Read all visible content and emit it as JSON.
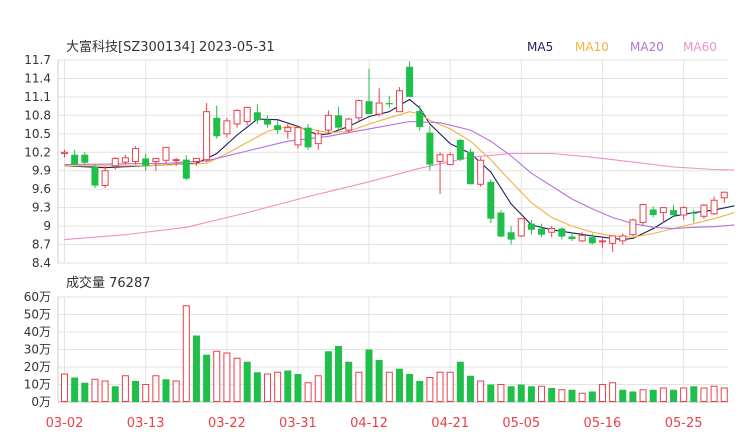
{
  "header": {
    "title": "大富科技[SZ300134] 2023-05-31",
    "legend": [
      {
        "label": "MA5",
        "color": "#1f1f5c"
      },
      {
        "label": "MA10",
        "color": "#f2b143"
      },
      {
        "label": "MA20",
        "color": "#b073d9"
      },
      {
        "label": "MA60",
        "color": "#f08fc8"
      }
    ]
  },
  "volume_header": {
    "label": "成交量 76287"
  },
  "colors": {
    "up": "#e8414a",
    "down": "#1fbf4a",
    "grid": "#e3e3e3",
    "axis_text": "#333333"
  },
  "chart_data": [
    {
      "type": "candlestick",
      "title": "大富科技[SZ300134] 2023-05-31",
      "y_ticks": [
        "11.7",
        "11.4",
        "11.1",
        "10.8",
        "10.5",
        "10.2",
        "9.9",
        "9.6",
        "9.3",
        "9",
        "8.7",
        "8.4"
      ],
      "ylim": [
        8.4,
        11.7
      ],
      "grid": true,
      "candles": [
        [
          10.18,
          10.24,
          10.12,
          10.2
        ],
        [
          10.16,
          10.24,
          9.99,
          10.0
        ],
        [
          10.16,
          10.2,
          10.0,
          10.03
        ],
        [
          9.96,
          10.0,
          9.62,
          9.66
        ],
        [
          9.66,
          9.97,
          9.62,
          9.9
        ],
        [
          9.98,
          10.12,
          9.92,
          10.1
        ],
        [
          10.04,
          10.16,
          10.0,
          10.11
        ],
        [
          10.05,
          10.3,
          10.0,
          10.26
        ],
        [
          10.1,
          10.18,
          9.9,
          9.98
        ],
        [
          10.05,
          10.1,
          9.9,
          10.1
        ],
        [
          10.07,
          10.28,
          10.02,
          10.28
        ],
        [
          10.07,
          10.11,
          9.98,
          10.08
        ],
        [
          10.08,
          10.15,
          9.75,
          9.77
        ],
        [
          10.05,
          10.1,
          9.98,
          10.1
        ],
        [
          10.08,
          11.0,
          10.04,
          10.86
        ],
        [
          10.76,
          10.96,
          10.42,
          10.46
        ],
        [
          10.5,
          10.76,
          10.44,
          10.71
        ],
        [
          10.66,
          10.9,
          10.6,
          10.88
        ],
        [
          10.7,
          10.94,
          10.64,
          10.93
        ],
        [
          10.85,
          10.98,
          10.66,
          10.72
        ],
        [
          10.73,
          10.8,
          10.6,
          10.65
        ],
        [
          10.64,
          10.72,
          10.5,
          10.56
        ],
        [
          10.54,
          10.66,
          10.42,
          10.6
        ],
        [
          10.32,
          10.62,
          10.26,
          10.6
        ],
        [
          10.6,
          10.66,
          10.24,
          10.28
        ],
        [
          10.34,
          10.56,
          10.24,
          10.5
        ],
        [
          10.56,
          10.88,
          10.5,
          10.8
        ],
        [
          10.8,
          10.94,
          10.56,
          10.6
        ],
        [
          10.56,
          10.76,
          10.52,
          10.74
        ],
        [
          10.76,
          11.06,
          10.7,
          11.04
        ],
        [
          11.03,
          11.56,
          10.84,
          10.82
        ],
        [
          10.82,
          11.24,
          10.78,
          11.0
        ],
        [
          11.0,
          11.12,
          10.92,
          10.98
        ],
        [
          10.86,
          11.26,
          10.86,
          11.2
        ],
        [
          11.59,
          11.68,
          11.12,
          11.1
        ],
        [
          10.87,
          10.96,
          10.55,
          10.61
        ],
        [
          10.52,
          10.62,
          9.9,
          10.0
        ],
        [
          10.05,
          10.2,
          9.52,
          10.16
        ],
        [
          10.0,
          10.2,
          10.0,
          10.16
        ],
        [
          10.4,
          10.42,
          10.06,
          10.08
        ],
        [
          10.21,
          10.26,
          9.68,
          9.68
        ],
        [
          9.68,
          10.12,
          9.64,
          10.07
        ],
        [
          9.72,
          9.76,
          9.05,
          9.12
        ],
        [
          9.22,
          9.26,
          8.82,
          8.83
        ],
        [
          8.9,
          9.0,
          8.7,
          8.78
        ],
        [
          8.84,
          9.12,
          8.82,
          9.12
        ],
        [
          9.04,
          9.1,
          8.86,
          8.94
        ],
        [
          8.96,
          9.04,
          8.82,
          8.86
        ],
        [
          8.9,
          9.0,
          8.82,
          8.96
        ],
        [
          8.96,
          8.98,
          8.78,
          8.83
        ],
        [
          8.83,
          8.9,
          8.76,
          8.79
        ],
        [
          8.76,
          8.9,
          8.74,
          8.85
        ],
        [
          8.82,
          8.88,
          8.7,
          8.72
        ],
        [
          8.76,
          8.8,
          8.64,
          8.76
        ],
        [
          8.72,
          8.84,
          8.58,
          8.84
        ],
        [
          8.76,
          8.88,
          8.7,
          8.84
        ],
        [
          8.86,
          9.12,
          8.84,
          9.1
        ],
        [
          9.06,
          9.28,
          9.02,
          9.35
        ],
        [
          9.27,
          9.32,
          9.14,
          9.18
        ],
        [
          9.22,
          9.3,
          9.06,
          9.3
        ],
        [
          9.26,
          9.34,
          9.16,
          9.18
        ],
        [
          9.18,
          9.32,
          9.1,
          9.3
        ],
        [
          9.22,
          9.26,
          9.06,
          9.2
        ],
        [
          9.16,
          9.36,
          9.12,
          9.34
        ],
        [
          9.2,
          9.48,
          9.18,
          9.42
        ],
        [
          9.46,
          9.56,
          9.38,
          9.55
        ]
      ],
      "ma_series": [
        {
          "name": "MA5",
          "color": "#1f1f5c",
          "points": [
            [
              0,
              9.98
            ],
            [
              4,
              9.95
            ],
            [
              8,
              9.98
            ],
            [
              13,
              10.02
            ],
            [
              15,
              10.18
            ],
            [
              17,
              10.48
            ],
            [
              19,
              10.74
            ],
            [
              21,
              10.73
            ],
            [
              23,
              10.62
            ],
            [
              25,
              10.48
            ],
            [
              26,
              10.5
            ],
            [
              28,
              10.62
            ],
            [
              30,
              10.78
            ],
            [
              32,
              10.86
            ],
            [
              33,
              10.96
            ],
            [
              34,
              11.06
            ],
            [
              35,
              10.92
            ],
            [
              36,
              10.66
            ],
            [
              38,
              10.34
            ],
            [
              40,
              10.18
            ],
            [
              42,
              9.88
            ],
            [
              44,
              9.36
            ],
            [
              46,
              9.02
            ],
            [
              48,
              8.94
            ],
            [
              52,
              8.84
            ],
            [
              55,
              8.78
            ],
            [
              56,
              8.8
            ],
            [
              58,
              8.96
            ],
            [
              60,
              9.16
            ],
            [
              62,
              9.22
            ],
            [
              64,
              9.26
            ],
            [
              66,
              9.33
            ]
          ]
        },
        {
          "name": "MA10",
          "color": "#f2b143",
          "points": [
            [
              0,
              9.98
            ],
            [
              8,
              9.98
            ],
            [
              14,
              10.02
            ],
            [
              16,
              10.18
            ],
            [
              18,
              10.36
            ],
            [
              20,
              10.54
            ],
            [
              22,
              10.62
            ],
            [
              24,
              10.58
            ],
            [
              26,
              10.52
            ],
            [
              28,
              10.54
            ],
            [
              30,
              10.66
            ],
            [
              32,
              10.76
            ],
            [
              34,
              10.86
            ],
            [
              35,
              10.82
            ],
            [
              36,
              10.72
            ],
            [
              38,
              10.58
            ],
            [
              40,
              10.38
            ],
            [
              42,
              10.08
            ],
            [
              44,
              9.72
            ],
            [
              46,
              9.38
            ],
            [
              48,
              9.14
            ],
            [
              50,
              9.0
            ],
            [
              52,
              8.9
            ],
            [
              54,
              8.84
            ],
            [
              56,
              8.82
            ],
            [
              58,
              8.88
            ],
            [
              60,
              8.96
            ],
            [
              62,
              9.04
            ],
            [
              64,
              9.12
            ],
            [
              66,
              9.22
            ]
          ]
        },
        {
          "name": "MA20",
          "color": "#b073d9",
          "points": [
            [
              0,
              10.0
            ],
            [
              10,
              10.02
            ],
            [
              14,
              10.06
            ],
            [
              18,
              10.22
            ],
            [
              22,
              10.38
            ],
            [
              26,
              10.46
            ],
            [
              30,
              10.58
            ],
            [
              34,
              10.7
            ],
            [
              37,
              10.68
            ],
            [
              40,
              10.56
            ],
            [
              42,
              10.38
            ],
            [
              44,
              10.14
            ],
            [
              46,
              9.86
            ],
            [
              50,
              9.44
            ],
            [
              52,
              9.28
            ],
            [
              54,
              9.14
            ],
            [
              56,
              9.04
            ],
            [
              58,
              8.98
            ],
            [
              60,
              8.96
            ],
            [
              62,
              8.98
            ],
            [
              64,
              8.99
            ],
            [
              66,
              9.02
            ]
          ]
        },
        {
          "name": "MA60",
          "color": "#f08fc8",
          "points": [
            [
              0,
              8.78
            ],
            [
              6,
              8.86
            ],
            [
              12,
              8.98
            ],
            [
              18,
              9.22
            ],
            [
              24,
              9.48
            ],
            [
              30,
              9.72
            ],
            [
              35,
              9.94
            ],
            [
              40,
              10.12
            ],
            [
              44,
              10.18
            ],
            [
              48,
              10.18
            ],
            [
              52,
              10.12
            ],
            [
              56,
              10.04
            ],
            [
              60,
              9.96
            ],
            [
              64,
              9.92
            ],
            [
              66,
              9.91
            ]
          ]
        }
      ]
    },
    {
      "type": "bar",
      "title": "成交量 76287",
      "y_ticks": [
        "60万",
        "50万",
        "40万",
        "30万",
        "20万",
        "10万",
        "0万"
      ],
      "ylim": [
        0,
        60
      ],
      "values": [
        16,
        14,
        11,
        13,
        12,
        9,
        15,
        12,
        10,
        15,
        13,
        12,
        55,
        38,
        27,
        29,
        28,
        25,
        23,
        17,
        16,
        17,
        18,
        16,
        11,
        15,
        29,
        32,
        23,
        17,
        30,
        24,
        17,
        19,
        16,
        12,
        14,
        17,
        17,
        23,
        15,
        12,
        10,
        10,
        9,
        10,
        9,
        9,
        8,
        7,
        7,
        5,
        6,
        10,
        11,
        7,
        6,
        7,
        7,
        8,
        7,
        8,
        9,
        8,
        9,
        8
      ],
      "direction": [
        "u",
        "d",
        "d",
        "u",
        "u",
        "d",
        "u",
        "d",
        "u",
        "u",
        "d",
        "u",
        "u",
        "d",
        "d",
        "u",
        "u",
        "u",
        "d",
        "d",
        "u",
        "u",
        "d",
        "d",
        "u",
        "u",
        "d",
        "d",
        "d",
        "u",
        "d",
        "d",
        "u",
        "d",
        "d",
        "d",
        "u",
        "u",
        "u",
        "d",
        "d",
        "u",
        "d",
        "u",
        "d",
        "d",
        "d",
        "u",
        "d",
        "u",
        "d",
        "u",
        "d",
        "u",
        "u",
        "d",
        "d",
        "u",
        "d",
        "u",
        "d",
        "u",
        "d",
        "u",
        "u",
        "u"
      ],
      "x_ticks": [
        {
          "index": 0,
          "label": "03-02"
        },
        {
          "index": 8,
          "label": "03-13"
        },
        {
          "index": 16,
          "label": "03-22"
        },
        {
          "index": 23,
          "label": "03-31"
        },
        {
          "index": 30,
          "label": "04-12"
        },
        {
          "index": 38,
          "label": "04-21"
        },
        {
          "index": 45,
          "label": "05-05"
        },
        {
          "index": 53,
          "label": "05-16"
        },
        {
          "index": 61,
          "label": "05-25"
        }
      ],
      "grid": true
    }
  ]
}
